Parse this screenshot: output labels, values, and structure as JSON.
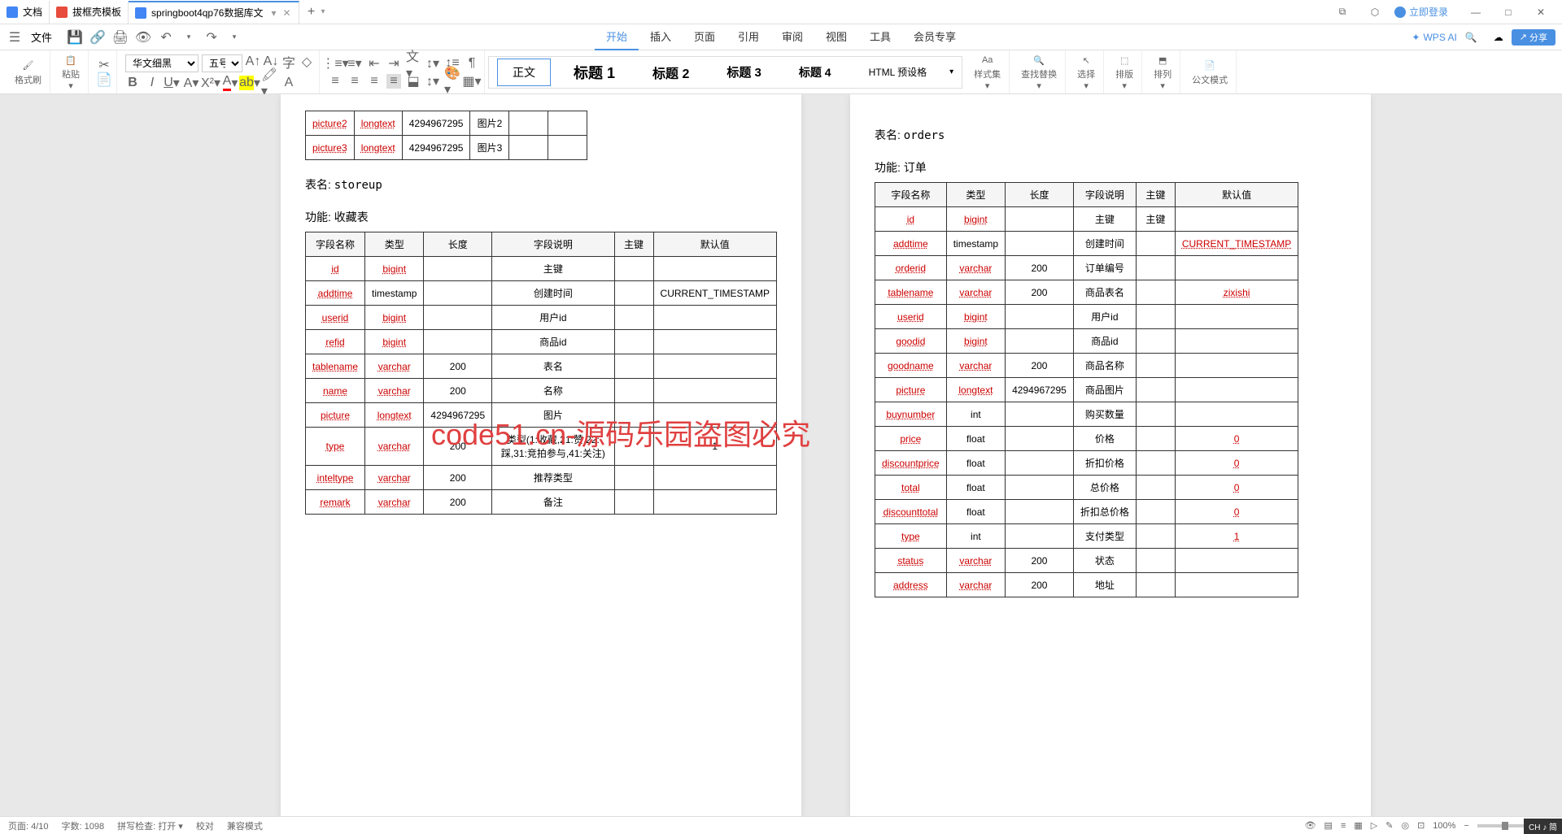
{
  "tabs": [
    {
      "label": "文档",
      "icon_color": "#4285f4"
    },
    {
      "label": "拔框壳模板",
      "icon_color": "#e74c3c"
    },
    {
      "label": "springboot4qp76数据库文",
      "icon_color": "#4285f4",
      "active": true
    }
  ],
  "window": {
    "login": "立即登录",
    "maximize": "□",
    "minimize": "—",
    "close": "✕"
  },
  "file_menu": "文件",
  "ribbon_tabs": [
    "开始",
    "插入",
    "页面",
    "引用",
    "审阅",
    "视图",
    "工具",
    "会员专享"
  ],
  "ribbon_active": 0,
  "wps_ai": "WPS AI",
  "share": "分享",
  "font": {
    "name": "华文细黑",
    "size": "五号"
  },
  "format_brush": "格式刷",
  "paste": "粘贴",
  "styles": [
    "正文",
    "标题 1",
    "标题 2",
    "标题 3",
    "标题 4",
    "HTML 预设格"
  ],
  "style_group": {
    "set": "样式集",
    "findreplace": "查找替换",
    "select": "选择",
    "layout": "排版",
    "sort": "排列",
    "official": "公文模式"
  },
  "page_left": {
    "partial_rows": [
      {
        "c1": "picture2",
        "c2": "longtext",
        "c3": "4294967295",
        "c4": "图片2",
        "c5": "",
        "c6": ""
      },
      {
        "c1": "picture3",
        "c2": "longtext",
        "c3": "4294967295",
        "c4": "图片3",
        "c5": "",
        "c6": ""
      }
    ],
    "table2": {
      "name_label": "表名:",
      "name": "storeup",
      "func_label": "功能:",
      "func": "收藏表",
      "headers": [
        "字段名称",
        "类型",
        "长度",
        "字段说明",
        "主键",
        "默认值"
      ],
      "rows": [
        {
          "c1": "id",
          "c2": "bigint",
          "c3": "",
          "c4": "主键",
          "c5": "",
          "c6": ""
        },
        {
          "c1": "addtime",
          "c2": "timestamp",
          "c3": "",
          "c4": "创建时间",
          "c5": "",
          "c6": "CURRENT_TIMESTAMP"
        },
        {
          "c1": "userid",
          "c2": "bigint",
          "c3": "",
          "c4": "用户id",
          "c5": "",
          "c6": ""
        },
        {
          "c1": "refid",
          "c2": "bigint",
          "c3": "",
          "c4": "商品id",
          "c5": "",
          "c6": ""
        },
        {
          "c1": "tablename",
          "c2": "varchar",
          "c3": "200",
          "c4": "表名",
          "c5": "",
          "c6": ""
        },
        {
          "c1": "name",
          "c2": "varchar",
          "c3": "200",
          "c4": "名称",
          "c5": "",
          "c6": ""
        },
        {
          "c1": "picture",
          "c2": "longtext",
          "c3": "4294967295",
          "c4": "图片",
          "c5": "",
          "c6": ""
        },
        {
          "c1": "type",
          "c2": "varchar",
          "c3": "200",
          "c4": "类型(1:收藏,21:赞,22:踩,31:竞拍参与,41:关注)",
          "c5": "",
          "c6": "1"
        },
        {
          "c1": "inteltype",
          "c2": "varchar",
          "c3": "200",
          "c4": "推荐类型",
          "c5": "",
          "c6": ""
        },
        {
          "c1": "remark",
          "c2": "varchar",
          "c3": "200",
          "c4": "备注",
          "c5": "",
          "c6": ""
        }
      ]
    }
  },
  "page_right": {
    "table": {
      "name_label": "表名:",
      "name": "orders",
      "func_label": "功能:",
      "func": "订单",
      "headers": [
        "字段名称",
        "类型",
        "长度",
        "字段说明",
        "主键",
        "默认值"
      ],
      "rows": [
        {
          "c1": "id",
          "c2": "bigint",
          "c3": "",
          "c4": "主键",
          "c5": "主键",
          "c6": ""
        },
        {
          "c1": "addtime",
          "c2": "timestamp",
          "c3": "",
          "c4": "创建时间",
          "c5": "",
          "c6": "CURRENT_TIMESTAMP"
        },
        {
          "c1": "orderid",
          "c2": "varchar",
          "c3": "200",
          "c4": "订单编号",
          "c5": "",
          "c6": ""
        },
        {
          "c1": "tablename",
          "c2": "varchar",
          "c3": "200",
          "c4": "商品表名",
          "c5": "",
          "c6": "zixishi"
        },
        {
          "c1": "userid",
          "c2": "bigint",
          "c3": "",
          "c4": "用户id",
          "c5": "",
          "c6": ""
        },
        {
          "c1": "goodid",
          "c2": "bigint",
          "c3": "",
          "c4": "商品id",
          "c5": "",
          "c6": ""
        },
        {
          "c1": "goodname",
          "c2": "varchar",
          "c3": "200",
          "c4": "商品名称",
          "c5": "",
          "c6": ""
        },
        {
          "c1": "picture",
          "c2": "longtext",
          "c3": "4294967295",
          "c4": "商品图片",
          "c5": "",
          "c6": ""
        },
        {
          "c1": "buynumber",
          "c2": "int",
          "c3": "",
          "c4": "购买数量",
          "c5": "",
          "c6": ""
        },
        {
          "c1": "price",
          "c2": "float",
          "c3": "",
          "c4": "价格",
          "c5": "",
          "c6": "0"
        },
        {
          "c1": "discountprice",
          "c2": "float",
          "c3": "",
          "c4": "折扣价格",
          "c5": "",
          "c6": "0"
        },
        {
          "c1": "total",
          "c2": "float",
          "c3": "",
          "c4": "总价格",
          "c5": "",
          "c6": "0"
        },
        {
          "c1": "discounttotal",
          "c2": "float",
          "c3": "",
          "c4": "折扣总价格",
          "c5": "",
          "c6": "0"
        },
        {
          "c1": "type",
          "c2": "int",
          "c3": "",
          "c4": "支付类型",
          "c5": "",
          "c6": "1"
        },
        {
          "c1": "status",
          "c2": "varchar",
          "c3": "200",
          "c4": "状态",
          "c5": "",
          "c6": ""
        },
        {
          "c1": "address",
          "c2": "varchar",
          "c3": "200",
          "c4": "地址",
          "c5": "",
          "c6": ""
        }
      ]
    }
  },
  "watermark": "code51.cn-源码乐园盗图必究",
  "statusbar": {
    "page": "页面: 4/10",
    "words": "字数: 1098",
    "spell": "拼写检查: 打开",
    "proof": "校对",
    "compat": "兼容模式",
    "zoom": "100%"
  },
  "lang": "CH ♪ 简"
}
